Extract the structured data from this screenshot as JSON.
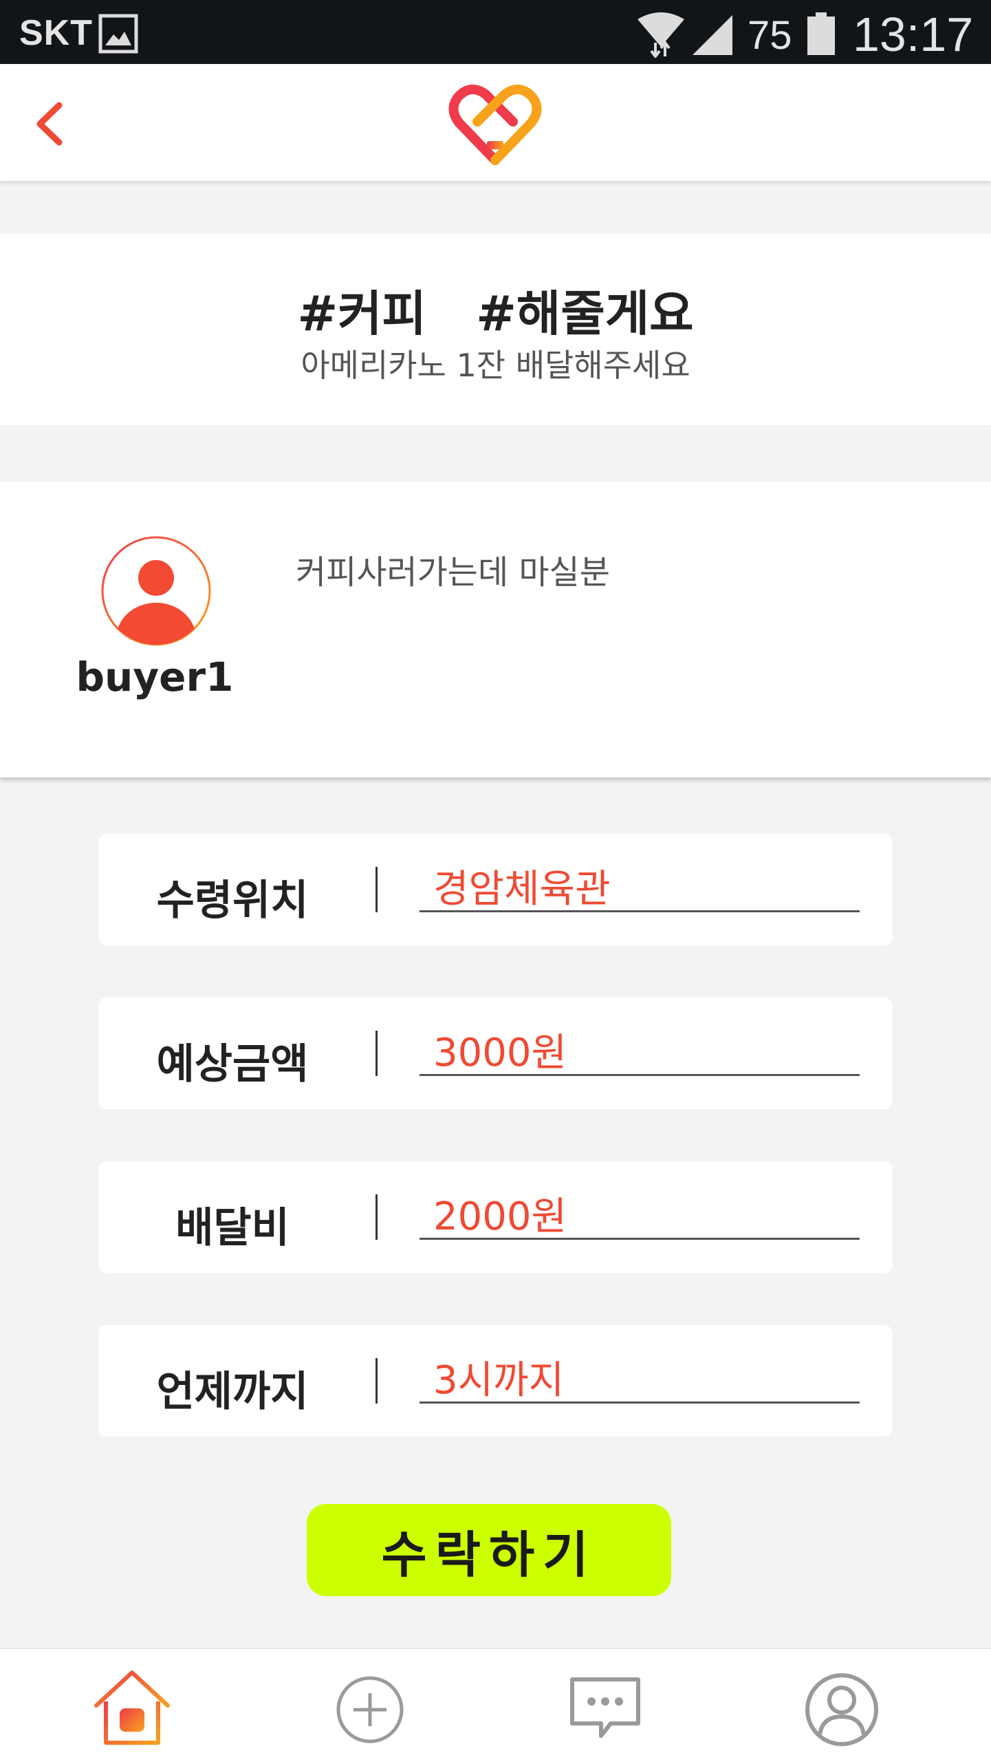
{
  "status_bar": {
    "carrier": "SKT",
    "battery_percent": "75",
    "time": "13:17",
    "icons": [
      "image-icon",
      "wifi-icon",
      "signal-icon",
      "battery-icon"
    ]
  },
  "header": {
    "back_icon": "chevron-left-icon",
    "logo_icon": "heart-handshake-logo"
  },
  "post": {
    "tags": [
      "#커피",
      "#해줄게요"
    ],
    "subtitle": "아메리카노 1잔 배달해주세요",
    "author": "buyer1",
    "avatar_icon": "user-avatar-icon",
    "body": "커피사러가는데 마실분"
  },
  "fields": [
    {
      "label": "수령위치",
      "value": "경암체육관"
    },
    {
      "label": "예상금액",
      "value": "3000원"
    },
    {
      "label": "배달비",
      "value": "2000원"
    },
    {
      "label": "언제까지",
      "value": "3시까지"
    }
  ],
  "accept_button": "수락하기",
  "bottom_nav": [
    {
      "name": "home",
      "icon": "home-icon",
      "active": true
    },
    {
      "name": "add",
      "icon": "plus-circle-icon",
      "active": false
    },
    {
      "name": "chat",
      "icon": "chat-bubble-icon",
      "active": false
    },
    {
      "name": "profile",
      "icon": "user-icon",
      "active": false
    }
  ],
  "colors": {
    "accent": "#ef4a33",
    "accent_orange": "#f7a21b",
    "button": "#ccff00",
    "status_bar": "#121518"
  }
}
